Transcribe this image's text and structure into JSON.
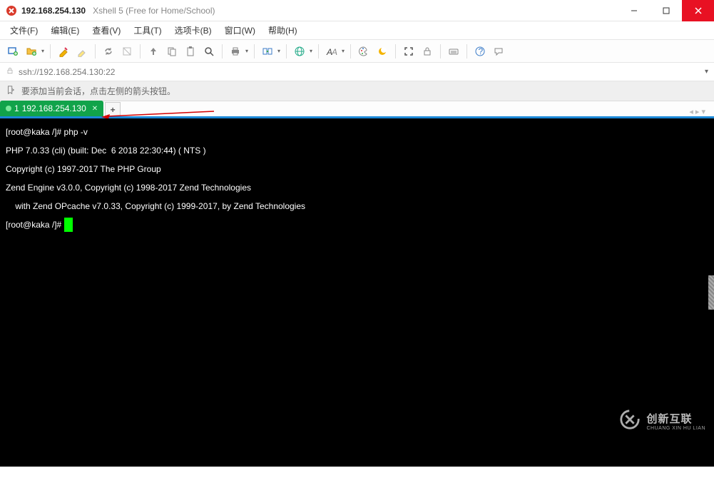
{
  "title": {
    "host": "192.168.254.130",
    "subtitle": "Xshell 5 (Free for Home/School)"
  },
  "menu": {
    "items": [
      "文件(F)",
      "编辑(E)",
      "查看(V)",
      "工具(T)",
      "选项卡(B)",
      "窗口(W)",
      "帮助(H)"
    ]
  },
  "toolbar_icons": [
    "new-session-icon",
    "new-folder-icon",
    "sep",
    "properties-icon",
    "highlight-icon",
    "sep",
    "reconnect-icon",
    "disconnect-icon",
    "sep",
    "arrow-up-icon",
    "copy-icon",
    "paste-icon",
    "search-icon",
    "sep",
    "print-icon",
    "dd",
    "sep",
    "transfer-icon",
    "dd",
    "sep",
    "globe-icon",
    "dd",
    "sep",
    "font-icon",
    "dd",
    "sep",
    "palette-icon",
    "theme-icon",
    "sep",
    "fullscreen-icon",
    "lock-icon",
    "sep",
    "keyboard-icon",
    "sep",
    "help-icon",
    "chat-icon"
  ],
  "addressbar": {
    "url": "ssh://192.168.254.130:22"
  },
  "hintbar": {
    "text": "要添加当前会话，点击左侧的箭头按钮。"
  },
  "tabs": {
    "active": {
      "index": "1",
      "label": "192.168.254.130"
    },
    "add": "+"
  },
  "terminal": {
    "lines": [
      "[root@kaka /]# php -v",
      "PHP 7.0.33 (cli) (built: Dec  6 2018 22:30:44) ( NTS )",
      "Copyright (c) 1997-2017 The PHP Group",
      "Zend Engine v3.0.0, Copyright (c) 1998-2017 Zend Technologies",
      "    with Zend OPcache v7.0.33, Copyright (c) 1999-2017, by Zend Technologies",
      "[root@kaka /]# "
    ]
  },
  "watermark": {
    "big": "创新互联",
    "small": "CHUANG XIN HU LIAN"
  }
}
